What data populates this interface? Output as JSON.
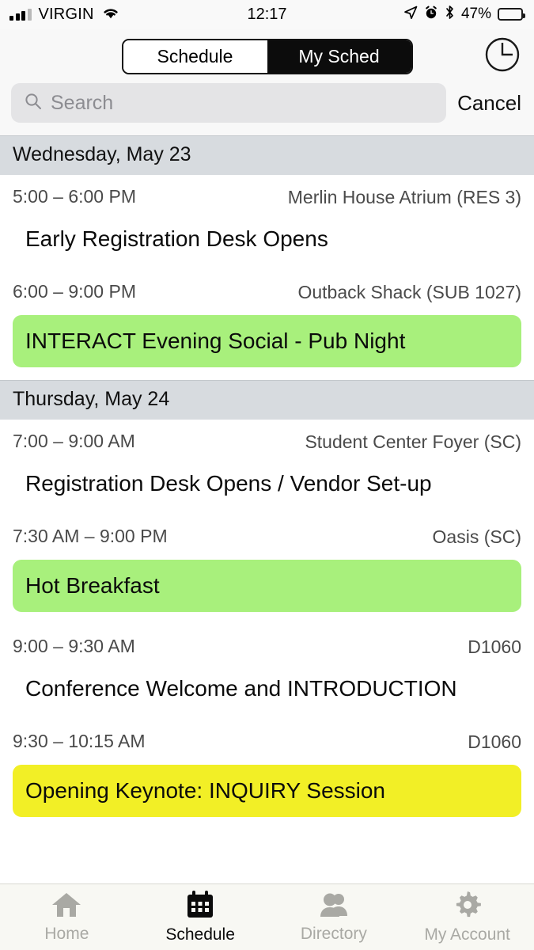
{
  "status_bar": {
    "carrier": "VIRGIN",
    "signal_icon": "cellular-signal-icon",
    "wifi_icon": "wifi-icon",
    "time": "12:17",
    "location_icon": "location-arrow-icon",
    "alarm_icon": "alarm-clock-icon",
    "bluetooth_icon": "bluetooth-icon",
    "battery_percent": "47%",
    "battery_icon": "battery-icon",
    "battery_level": 47
  },
  "header": {
    "segmented_control": {
      "options": [
        "Schedule",
        "My Sched"
      ],
      "selected": "My Sched"
    },
    "clock_button_icon": "clock-icon"
  },
  "search": {
    "icon": "search-icon",
    "placeholder": "Search",
    "value": "",
    "cancel_label": "Cancel"
  },
  "schedule": {
    "days": [
      {
        "date_label": "Wednesday, May 23",
        "events": [
          {
            "time": "5:00 – 6:00 PM",
            "location": "Merlin House Atrium (RES 3)",
            "title": "Early Registration Desk Opens",
            "highlight": "none"
          },
          {
            "time": "6:00 – 9:00 PM",
            "location": "Outback Shack (SUB 1027)",
            "title": "INTERACT Evening Social - Pub Night",
            "highlight": "green"
          }
        ]
      },
      {
        "date_label": "Thursday, May 24",
        "events": [
          {
            "time": "7:00 – 9:00 AM",
            "location": "Student Center Foyer (SC)",
            "title": "Registration Desk Opens / Vendor Set-up",
            "highlight": "none"
          },
          {
            "time": "7:30 AM – 9:00 PM",
            "location": "Oasis (SC)",
            "title": "Hot Breakfast",
            "highlight": "green"
          },
          {
            "time": "9:00 – 9:30 AM",
            "location": "D1060",
            "title": "Conference Welcome and INTRODUCTION",
            "highlight": "none"
          },
          {
            "time": "9:30 – 10:15 AM",
            "location": "D1060",
            "title": "Opening Keynote: INQUIRY Session",
            "highlight": "yellow"
          }
        ]
      }
    ]
  },
  "tabbar": {
    "items": [
      {
        "label": "Home",
        "icon": "home-icon",
        "active": false
      },
      {
        "label": "Schedule",
        "icon": "calendar-icon",
        "active": true
      },
      {
        "label": "Directory",
        "icon": "people-icon",
        "active": false
      },
      {
        "label": "My Account",
        "icon": "gear-icon",
        "active": false
      }
    ]
  },
  "colors": {
    "highlight_green": "#a8f07c",
    "highlight_yellow": "#f2ef26",
    "day_header_bg": "#d7dbdf",
    "accent_black": "#0c0c0c"
  }
}
